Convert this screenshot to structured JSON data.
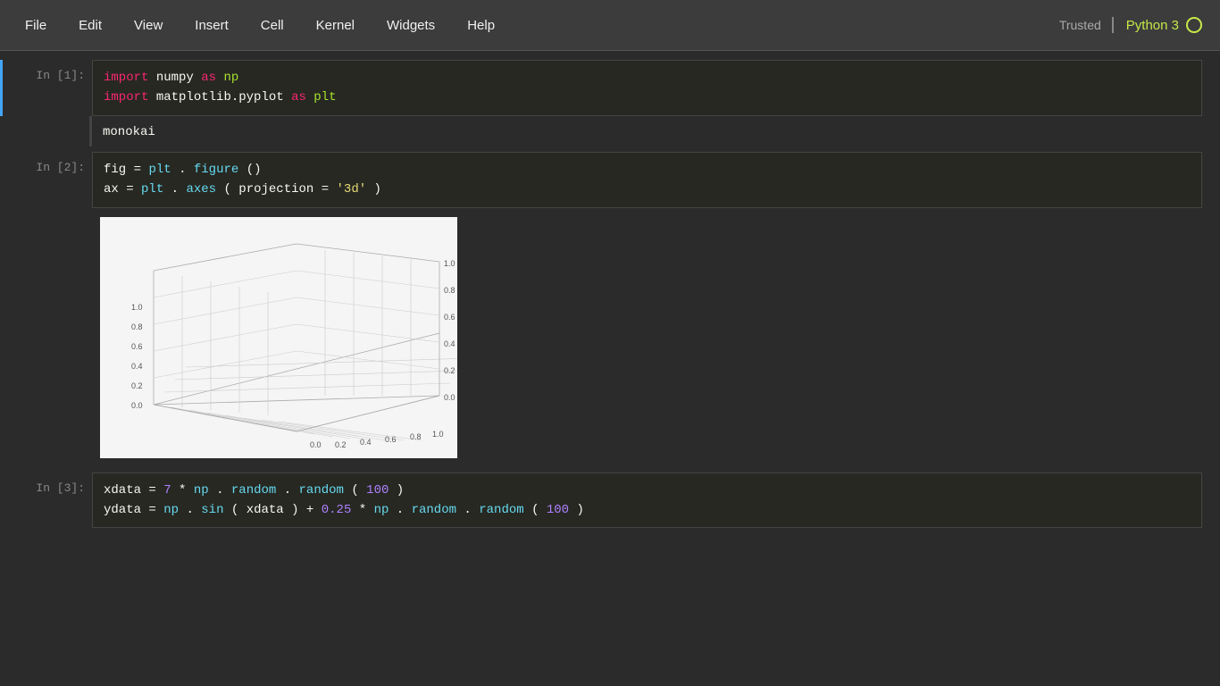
{
  "menubar": {
    "items": [
      "File",
      "Edit",
      "View",
      "Insert",
      "Cell",
      "Kernel",
      "Widgets",
      "Help"
    ],
    "trusted": "Trusted",
    "kernel": "Python 3"
  },
  "cells": [
    {
      "id": "cell1",
      "label": "In [1]:",
      "type": "code",
      "lines": [
        {
          "tokens": [
            {
              "type": "kw",
              "text": "import"
            },
            {
              "type": "nm",
              "text": " numpy "
            },
            {
              "type": "kw",
              "text": "as"
            },
            {
              "type": "mod",
              "text": " np"
            }
          ]
        },
        {
          "tokens": [
            {
              "type": "kw",
              "text": "import"
            },
            {
              "type": "nm",
              "text": " matplotlib.pyplot "
            },
            {
              "type": "kw",
              "text": "as"
            },
            {
              "type": "mod",
              "text": " plt"
            }
          ]
        }
      ]
    },
    {
      "id": "output1",
      "type": "output",
      "text": "monokai"
    },
    {
      "id": "cell2",
      "label": "In [2]:",
      "type": "code",
      "lines": [
        {
          "tokens": [
            {
              "type": "nm",
              "text": "fig"
            },
            {
              "type": "op",
              "text": " = "
            },
            {
              "type": "fn",
              "text": "plt"
            },
            {
              "type": "op",
              "text": "."
            },
            {
              "type": "fn",
              "text": "figure"
            },
            {
              "type": "op",
              "text": "()"
            }
          ]
        },
        {
          "tokens": [
            {
              "type": "nm",
              "text": "ax"
            },
            {
              "type": "op",
              "text": " = "
            },
            {
              "type": "fn",
              "text": "plt"
            },
            {
              "type": "op",
              "text": "."
            },
            {
              "type": "fn",
              "text": "axes"
            },
            {
              "type": "op",
              "text": "("
            },
            {
              "type": "nm",
              "text": "projection"
            },
            {
              "type": "op",
              "text": " = "
            },
            {
              "type": "str",
              "text": "'3d'"
            },
            {
              "type": "op",
              "text": ")"
            }
          ]
        }
      ]
    },
    {
      "id": "cell3",
      "label": "In [3]:",
      "type": "code",
      "lines": [
        {
          "tokens": [
            {
              "type": "nm",
              "text": "xdata"
            },
            {
              "type": "op",
              "text": " = "
            },
            {
              "type": "num",
              "text": "7"
            },
            {
              "type": "op",
              "text": " * "
            },
            {
              "type": "fn",
              "text": "np"
            },
            {
              "type": "op",
              "text": "."
            },
            {
              "type": "fn",
              "text": "random"
            },
            {
              "type": "op",
              "text": "."
            },
            {
              "type": "fn",
              "text": "random"
            },
            {
              "type": "op",
              "text": "("
            },
            {
              "type": "num",
              "text": "100"
            },
            {
              "type": "op",
              "text": ")"
            }
          ]
        },
        {
          "tokens": [
            {
              "type": "nm",
              "text": "ydata"
            },
            {
              "type": "op",
              "text": " = "
            },
            {
              "type": "fn",
              "text": "np"
            },
            {
              "type": "op",
              "text": "."
            },
            {
              "type": "fn",
              "text": "sin"
            },
            {
              "type": "op",
              "text": "("
            },
            {
              "type": "nm",
              "text": "xdata"
            },
            {
              "type": "op",
              "text": ") + "
            },
            {
              "type": "num",
              "text": "0.25"
            },
            {
              "type": "op",
              "text": " * "
            },
            {
              "type": "fn",
              "text": "np"
            },
            {
              "type": "op",
              "text": "."
            },
            {
              "type": "fn",
              "text": "random"
            },
            {
              "type": "op",
              "text": "."
            },
            {
              "type": "fn",
              "text": "random"
            },
            {
              "type": "op",
              "text": "("
            },
            {
              "type": "num",
              "text": "100"
            },
            {
              "type": "op",
              "text": ")"
            }
          ]
        }
      ]
    }
  ],
  "plot": {
    "axis_labels": {
      "x": [
        "0.0",
        "0.2",
        "0.4",
        "0.6",
        "0.8",
        "1.0"
      ],
      "y": [
        "0.0",
        "0.2",
        "0.4",
        "0.6",
        "0.8",
        "1.0"
      ],
      "z": [
        "0.0",
        "0.2",
        "0.4",
        "0.6",
        "0.8",
        "1.0"
      ]
    }
  }
}
